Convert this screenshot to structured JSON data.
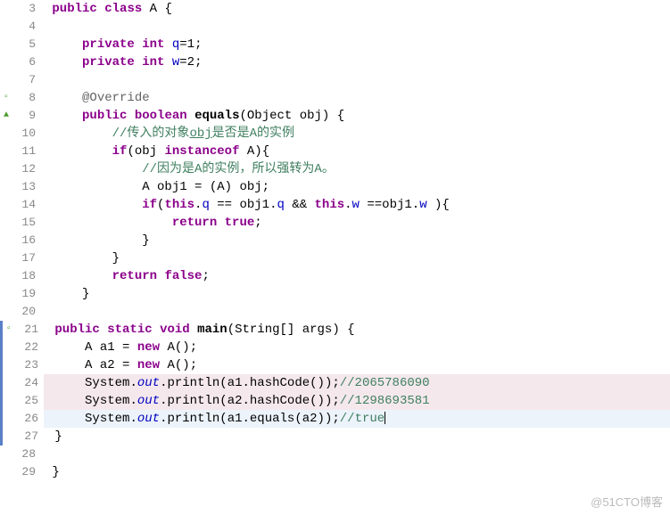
{
  "watermark": "@51CTO博客",
  "lines": [
    {
      "num": "3",
      "icon": "",
      "bar": false,
      "hl": "",
      "tokens": [
        [
          "plain",
          " "
        ],
        [
          "kw",
          "public"
        ],
        [
          "plain",
          " "
        ],
        [
          "kw",
          "class"
        ],
        [
          "plain",
          " A "
        ],
        [
          "punc",
          "{"
        ]
      ]
    },
    {
      "num": "4",
      "icon": "",
      "bar": false,
      "hl": "",
      "tokens": []
    },
    {
      "num": "5",
      "icon": "",
      "bar": false,
      "hl": "",
      "tokens": [
        [
          "plain",
          "     "
        ],
        [
          "kw",
          "private"
        ],
        [
          "plain",
          " "
        ],
        [
          "kw",
          "int"
        ],
        [
          "plain",
          " "
        ],
        [
          "fld",
          "q"
        ],
        [
          "plain",
          "="
        ],
        [
          "num",
          "1"
        ],
        [
          "punc",
          ";"
        ]
      ]
    },
    {
      "num": "6",
      "icon": "",
      "bar": false,
      "hl": "",
      "tokens": [
        [
          "plain",
          "     "
        ],
        [
          "kw",
          "private"
        ],
        [
          "plain",
          " "
        ],
        [
          "kw",
          "int"
        ],
        [
          "plain",
          " "
        ],
        [
          "fld",
          "w"
        ],
        [
          "plain",
          "="
        ],
        [
          "num",
          "2"
        ],
        [
          "punc",
          ";"
        ]
      ]
    },
    {
      "num": "7",
      "icon": "",
      "bar": false,
      "hl": "",
      "tokens": []
    },
    {
      "num": "8",
      "icon": "sq",
      "bar": false,
      "hl": "",
      "tokens": [
        [
          "plain",
          "     "
        ],
        [
          "ann",
          "@Override"
        ]
      ]
    },
    {
      "num": "9",
      "icon": "tri",
      "bar": false,
      "hl": "",
      "tokens": [
        [
          "plain",
          "     "
        ],
        [
          "kw",
          "public"
        ],
        [
          "plain",
          " "
        ],
        [
          "kw",
          "boolean"
        ],
        [
          "plain",
          " "
        ],
        [
          "method",
          "equals"
        ],
        [
          "punc",
          "("
        ],
        [
          "plain",
          "Object obj"
        ],
        [
          "punc",
          ")"
        ],
        [
          "plain",
          " "
        ],
        [
          "punc",
          "{"
        ]
      ]
    },
    {
      "num": "10",
      "icon": "",
      "bar": false,
      "hl": "",
      "tokens": [
        [
          "plain",
          "         "
        ],
        [
          "cmt",
          "//传入的对象"
        ],
        [
          "cmt-red",
          "obj"
        ],
        [
          "cmt",
          "是否是A的实例"
        ]
      ]
    },
    {
      "num": "11",
      "icon": "",
      "bar": false,
      "hl": "",
      "tokens": [
        [
          "plain",
          "         "
        ],
        [
          "kw",
          "if"
        ],
        [
          "punc",
          "("
        ],
        [
          "plain",
          "obj "
        ],
        [
          "kw",
          "instanceof"
        ],
        [
          "plain",
          " A"
        ],
        [
          "punc",
          ")"
        ],
        [
          "punc",
          "{"
        ]
      ]
    },
    {
      "num": "12",
      "icon": "",
      "bar": false,
      "hl": "",
      "tokens": [
        [
          "plain",
          "             "
        ],
        [
          "cmt",
          "//因为是A的实例，所以强转为A。"
        ]
      ]
    },
    {
      "num": "13",
      "icon": "",
      "bar": false,
      "hl": "",
      "tokens": [
        [
          "plain",
          "             "
        ],
        [
          "plain",
          "A obj1 "
        ],
        [
          "punc",
          "="
        ],
        [
          "plain",
          " "
        ],
        [
          "punc",
          "("
        ],
        [
          "plain",
          "A"
        ],
        [
          "punc",
          ")"
        ],
        [
          "plain",
          " obj"
        ],
        [
          "punc",
          ";"
        ]
      ]
    },
    {
      "num": "14",
      "icon": "",
      "bar": false,
      "hl": "",
      "tokens": [
        [
          "plain",
          "             "
        ],
        [
          "kw",
          "if"
        ],
        [
          "punc",
          "("
        ],
        [
          "kw",
          "this"
        ],
        [
          "punc",
          "."
        ],
        [
          "fld",
          "q"
        ],
        [
          "plain",
          " "
        ],
        [
          "punc",
          "=="
        ],
        [
          "plain",
          " obj1"
        ],
        [
          "punc",
          "."
        ],
        [
          "fld",
          "q"
        ],
        [
          "plain",
          " "
        ],
        [
          "punc",
          "&&"
        ],
        [
          "plain",
          " "
        ],
        [
          "kw",
          "this"
        ],
        [
          "punc",
          "."
        ],
        [
          "fld",
          "w"
        ],
        [
          "plain",
          " "
        ],
        [
          "punc",
          "=="
        ],
        [
          "plain",
          "obj1"
        ],
        [
          "punc",
          "."
        ],
        [
          "fld",
          "w"
        ],
        [
          "plain",
          " "
        ],
        [
          "punc",
          ")"
        ],
        [
          "punc",
          "{"
        ]
      ]
    },
    {
      "num": "15",
      "icon": "",
      "bar": false,
      "hl": "",
      "tokens": [
        [
          "plain",
          "                 "
        ],
        [
          "kw",
          "return"
        ],
        [
          "plain",
          " "
        ],
        [
          "kw",
          "true"
        ],
        [
          "punc",
          ";"
        ]
      ]
    },
    {
      "num": "16",
      "icon": "",
      "bar": false,
      "hl": "",
      "tokens": [
        [
          "plain",
          "             "
        ],
        [
          "punc",
          "}"
        ]
      ]
    },
    {
      "num": "17",
      "icon": "",
      "bar": false,
      "hl": "",
      "tokens": [
        [
          "plain",
          "         "
        ],
        [
          "punc",
          "}"
        ]
      ]
    },
    {
      "num": "18",
      "icon": "",
      "bar": false,
      "hl": "",
      "tokens": [
        [
          "plain",
          "         "
        ],
        [
          "kw",
          "return"
        ],
        [
          "plain",
          " "
        ],
        [
          "kw",
          "false"
        ],
        [
          "punc",
          ";"
        ]
      ]
    },
    {
      "num": "19",
      "icon": "",
      "bar": false,
      "hl": "",
      "tokens": [
        [
          "plain",
          "     "
        ],
        [
          "punc",
          "}"
        ]
      ]
    },
    {
      "num": "20",
      "icon": "",
      "bar": false,
      "hl": "",
      "tokens": []
    },
    {
      "num": "21",
      "icon": "sq",
      "bar": true,
      "hl": "",
      "tokens": [
        [
          "plain",
          " "
        ],
        [
          "kw",
          "public"
        ],
        [
          "plain",
          " "
        ],
        [
          "kw",
          "static"
        ],
        [
          "plain",
          " "
        ],
        [
          "kw",
          "void"
        ],
        [
          "plain",
          " "
        ],
        [
          "method",
          "main"
        ],
        [
          "punc",
          "("
        ],
        [
          "plain",
          "String"
        ],
        [
          "punc",
          "["
        ],
        [
          "punc",
          "]"
        ],
        [
          "plain",
          " args"
        ],
        [
          "punc",
          ")"
        ],
        [
          "plain",
          " "
        ],
        [
          "punc",
          "{"
        ]
      ]
    },
    {
      "num": "22",
      "icon": "",
      "bar": true,
      "hl": "",
      "tokens": [
        [
          "plain",
          "     "
        ],
        [
          "plain",
          "A a1 "
        ],
        [
          "punc",
          "="
        ],
        [
          "plain",
          " "
        ],
        [
          "kw",
          "new"
        ],
        [
          "plain",
          " A"
        ],
        [
          "punc",
          "("
        ],
        [
          "punc",
          ")"
        ],
        [
          "punc",
          ";"
        ]
      ]
    },
    {
      "num": "23",
      "icon": "",
      "bar": true,
      "hl": "",
      "tokens": [
        [
          "plain",
          "     "
        ],
        [
          "plain",
          "A a2 "
        ],
        [
          "punc",
          "="
        ],
        [
          "plain",
          " "
        ],
        [
          "kw",
          "new"
        ],
        [
          "plain",
          " A"
        ],
        [
          "punc",
          "("
        ],
        [
          "punc",
          ")"
        ],
        [
          "punc",
          ";"
        ]
      ]
    },
    {
      "num": "24",
      "icon": "",
      "bar": true,
      "hl": "highlight",
      "tokens": [
        [
          "plain",
          "     "
        ],
        [
          "plain",
          "System"
        ],
        [
          "punc",
          "."
        ],
        [
          "fldit",
          "out"
        ],
        [
          "punc",
          "."
        ],
        [
          "plain",
          "println"
        ],
        [
          "punc",
          "("
        ],
        [
          "plain",
          "a1"
        ],
        [
          "punc",
          "."
        ],
        [
          "plain",
          "hashCode"
        ],
        [
          "punc",
          "("
        ],
        [
          "punc",
          ")"
        ],
        [
          "punc",
          ")"
        ],
        [
          "punc",
          ";"
        ],
        [
          "cmt",
          "//2065786090"
        ]
      ]
    },
    {
      "num": "25",
      "icon": "",
      "bar": true,
      "hl": "highlight",
      "tokens": [
        [
          "plain",
          "     "
        ],
        [
          "plain",
          "System"
        ],
        [
          "punc",
          "."
        ],
        [
          "fldit",
          "out"
        ],
        [
          "punc",
          "."
        ],
        [
          "plain",
          "println"
        ],
        [
          "punc",
          "("
        ],
        [
          "plain",
          "a2"
        ],
        [
          "punc",
          "."
        ],
        [
          "plain",
          "hashCode"
        ],
        [
          "punc",
          "("
        ],
        [
          "punc",
          ")"
        ],
        [
          "punc",
          ")"
        ],
        [
          "punc",
          ";"
        ],
        [
          "cmt",
          "//1298693581"
        ]
      ]
    },
    {
      "num": "26",
      "icon": "",
      "bar": true,
      "hl": "current",
      "tokens": [
        [
          "plain",
          "     "
        ],
        [
          "plain",
          "System"
        ],
        [
          "punc",
          "."
        ],
        [
          "fldit",
          "out"
        ],
        [
          "punc",
          "."
        ],
        [
          "plain",
          "println"
        ],
        [
          "punc",
          "("
        ],
        [
          "plain",
          "a1"
        ],
        [
          "punc",
          "."
        ],
        [
          "plain",
          "equals"
        ],
        [
          "punc",
          "("
        ],
        [
          "plain",
          "a2"
        ],
        [
          "punc",
          ")"
        ],
        [
          "punc",
          ")"
        ],
        [
          "punc",
          ";"
        ],
        [
          "cmt",
          "//true"
        ]
      ],
      "caret": true
    },
    {
      "num": "27",
      "icon": "",
      "bar": true,
      "hl": "",
      "tokens": [
        [
          "plain",
          " "
        ],
        [
          "punc",
          "}"
        ]
      ]
    },
    {
      "num": "28",
      "icon": "",
      "bar": false,
      "hl": "",
      "tokens": []
    },
    {
      "num": "29",
      "icon": "",
      "bar": false,
      "hl": "",
      "tokens": [
        [
          "plain",
          " "
        ],
        [
          "punc",
          "}"
        ]
      ]
    }
  ]
}
